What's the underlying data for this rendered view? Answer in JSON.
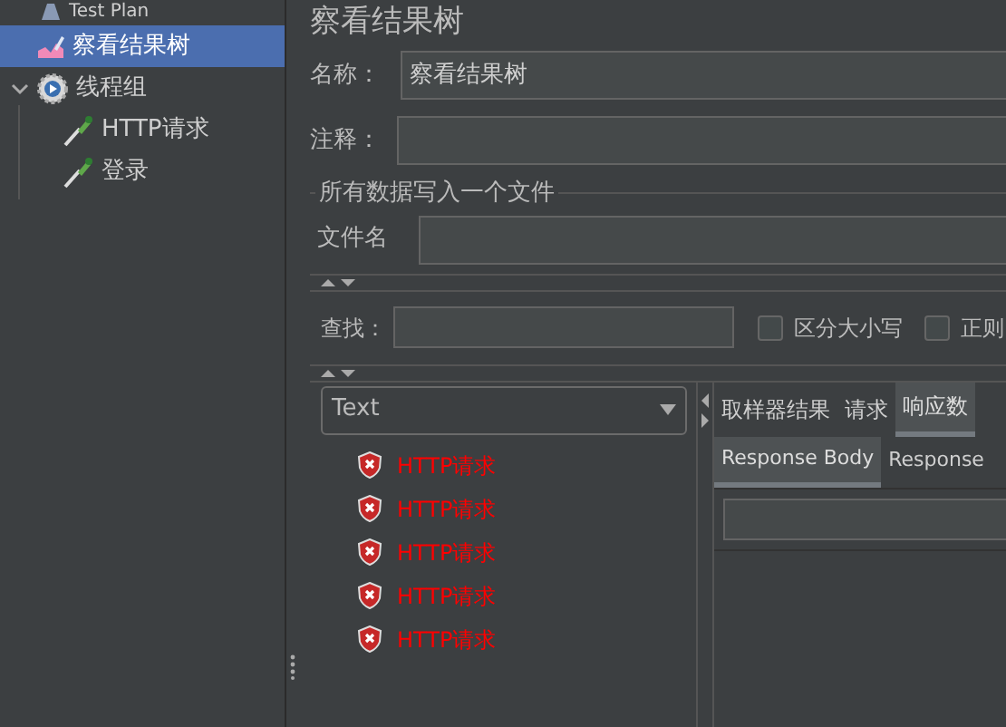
{
  "tree": [
    {
      "label": "Test Plan",
      "kind": "plan",
      "selected": false,
      "children": [
        {
          "label": "察看结果树",
          "kind": "listener",
          "selected": true
        },
        {
          "label": "线程组",
          "kind": "thread_group",
          "selected": false,
          "expanded": true,
          "children": [
            {
              "label": "HTTP请求",
              "kind": "sampler",
              "selected": false
            },
            {
              "label": "登录",
              "kind": "sampler",
              "selected": false
            }
          ]
        }
      ]
    }
  ],
  "panel": {
    "title": "察看结果树",
    "name_field": {
      "label": "名称：",
      "value": "察看结果树"
    },
    "comment_field": {
      "label": "注释："
    },
    "file_group": {
      "legend": "所有数据写入一个文件",
      "filename_label": "文件名"
    },
    "search": {
      "label": "查找：",
      "options": [
        {
          "label": "区分大小写",
          "checked": false
        },
        {
          "label": "正则",
          "checked": false
        }
      ]
    },
    "renderer": {
      "value": "Text"
    },
    "results": [
      {
        "label": "HTTP请求",
        "failed": true
      },
      {
        "label": "HTTP请求",
        "failed": true
      },
      {
        "label": "HTTP请求",
        "failed": true
      },
      {
        "label": "HTTP请求",
        "failed": true
      },
      {
        "label": "HTTP请求",
        "failed": true
      }
    ],
    "tabs": [
      {
        "label": "取样器结果",
        "selected": false
      },
      {
        "label": "请求",
        "selected": false
      },
      {
        "label": "响应数",
        "selected": true
      }
    ],
    "subtabs": [
      {
        "label": "Response Body",
        "selected": true
      },
      {
        "label": "Response",
        "selected": false
      }
    ]
  }
}
